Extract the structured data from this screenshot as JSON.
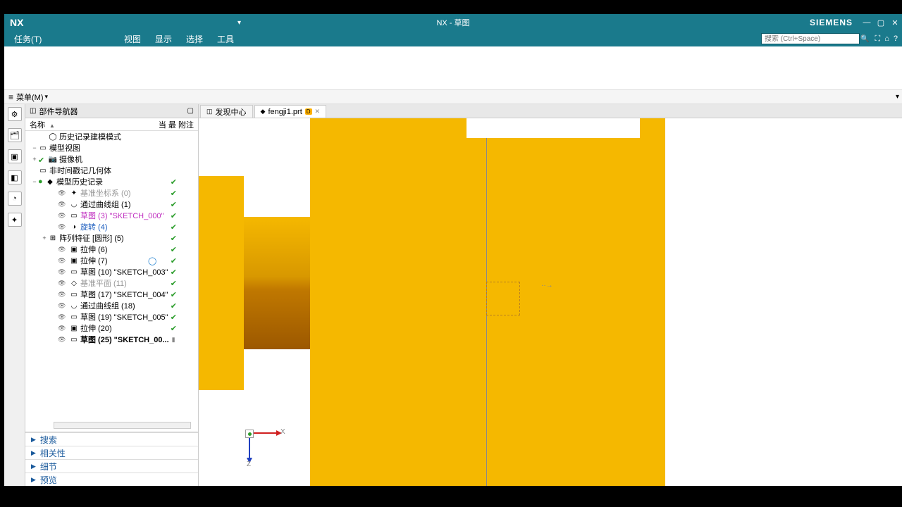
{
  "titlebar": {
    "logo": "NX",
    "title": "NX - 草图",
    "brand": "SIEMENS"
  },
  "menubar": {
    "task": "任务(T)",
    "items": [
      "视图",
      "显示",
      "选择",
      "工具"
    ],
    "search_placeholder": "搜索 (Ctrl+Space)"
  },
  "menu_strip": {
    "label": "菜单(M)"
  },
  "nav": {
    "title": "部件导航器",
    "col_name": "名称",
    "col_r": "当  最  附注"
  },
  "tree": [
    {
      "indent": 1,
      "exp": "",
      "nico": "◯",
      "label": "历史记录建模模式",
      "misc": ""
    },
    {
      "indent": 0,
      "exp": "−",
      "nico": "▭",
      "label": "模型视图",
      "misc": ""
    },
    {
      "indent": 0,
      "exp": "+",
      "cb": true,
      "nico": "📷",
      "label": "摄像机",
      "misc": ""
    },
    {
      "indent": 0,
      "exp": "",
      "nico": "▭",
      "label": "非时间戳记几何体",
      "misc": ""
    },
    {
      "indent": 0,
      "exp": "−",
      "dot": "green",
      "nico": "◆",
      "label": "模型历史记录",
      "chk": true
    },
    {
      "indent": 2,
      "nico": "✦",
      "label": "基准坐标系 (0)",
      "cls": "dim",
      "chk": true
    },
    {
      "indent": 2,
      "nico": "◡",
      "label": "通过曲线组 (1)",
      "chk": true
    },
    {
      "indent": 2,
      "nico": "▭",
      "label": "草图 (3) \"SKETCH_000\"",
      "cls": "magenta",
      "chk": true
    },
    {
      "indent": 2,
      "nico": "◑",
      "label": "旋转 (4)",
      "cls": "blue",
      "chk": true
    },
    {
      "indent": 1,
      "exp": "+",
      "nico": "⊞",
      "label": "阵列特征 [圆形] (5)",
      "chk": true
    },
    {
      "indent": 2,
      "nico": "▣",
      "label": "拉伸 (6)",
      "chk": true
    },
    {
      "indent": 2,
      "nico": "▣",
      "label": "拉伸 (7)",
      "chk": true,
      "spin": true
    },
    {
      "indent": 2,
      "nico": "▭",
      "label": "草图 (10) \"SKETCH_003\"",
      "chk": true
    },
    {
      "indent": 2,
      "nico": "◇",
      "label": "基准平面 (11)",
      "cls": "dim",
      "chk": true
    },
    {
      "indent": 2,
      "nico": "▭",
      "label": "草图 (17) \"SKETCH_004\"",
      "chk": true
    },
    {
      "indent": 2,
      "nico": "◡",
      "label": "通过曲线组 (18)",
      "chk": true
    },
    {
      "indent": 2,
      "nico": "▭",
      "label": "草图 (19) \"SKETCH_005\"",
      "chk": true
    },
    {
      "indent": 2,
      "nico": "▣",
      "label": "拉伸 (20)",
      "chk": true
    },
    {
      "indent": 2,
      "nico": "▭",
      "label": "草图 (25) \"SKETCH_00...",
      "cls": "bold",
      "ed": true
    }
  ],
  "foot_panels": [
    "搜索",
    "相关性",
    "细节",
    "预览"
  ],
  "tabs": [
    {
      "ico": "◫",
      "label": "发现中心",
      "active": false,
      "close": false
    },
    {
      "ico": "◆",
      "label": "fengji1.prt",
      "active": true,
      "close": true,
      "badge": "D"
    }
  ],
  "csys": {
    "x": "X",
    "z": "Z"
  }
}
